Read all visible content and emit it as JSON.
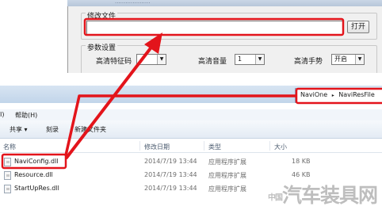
{
  "dialog": {
    "title_fragment": "....................",
    "file_group_label": "修改文件",
    "file_path_value": "",
    "open_button_label": "打开",
    "params_group_label": "参数设置",
    "params": [
      {
        "label": "高清特征码",
        "value": ""
      },
      {
        "label": "高清音量",
        "value": "1"
      },
      {
        "label": "高清手势",
        "value": "开启"
      }
    ]
  },
  "explorer": {
    "breadcrumb": {
      "segments": [
        "NaviOne",
        "NaviResFile"
      ],
      "separator": "▸"
    },
    "menu": {
      "partial_item": "I)",
      "help": "帮助(H)"
    },
    "toolbar": {
      "share": "共享 ▾",
      "burn": "刻录",
      "new_folder": "新建文件夹"
    },
    "columns": [
      "名称",
      "修改日期",
      "类型",
      "大小"
    ],
    "files": [
      {
        "name": "NaviConfig.dll",
        "date": "2014/7/19 13:44",
        "type": "应用程序扩展",
        "size": "18 KB"
      },
      {
        "name": "Resource.dll",
        "date": "2014/7/19 13:44",
        "type": "应用程序扩展",
        "size": "46 KB"
      },
      {
        "name": "StartUpRes.dll",
        "date": "2014/7/19 13:44",
        "type": "应用程序扩展",
        "size": ""
      }
    ]
  },
  "annotation": {
    "color": "#e3141b"
  },
  "watermark": {
    "text": "汽车装具网",
    "prefix": "中国"
  }
}
